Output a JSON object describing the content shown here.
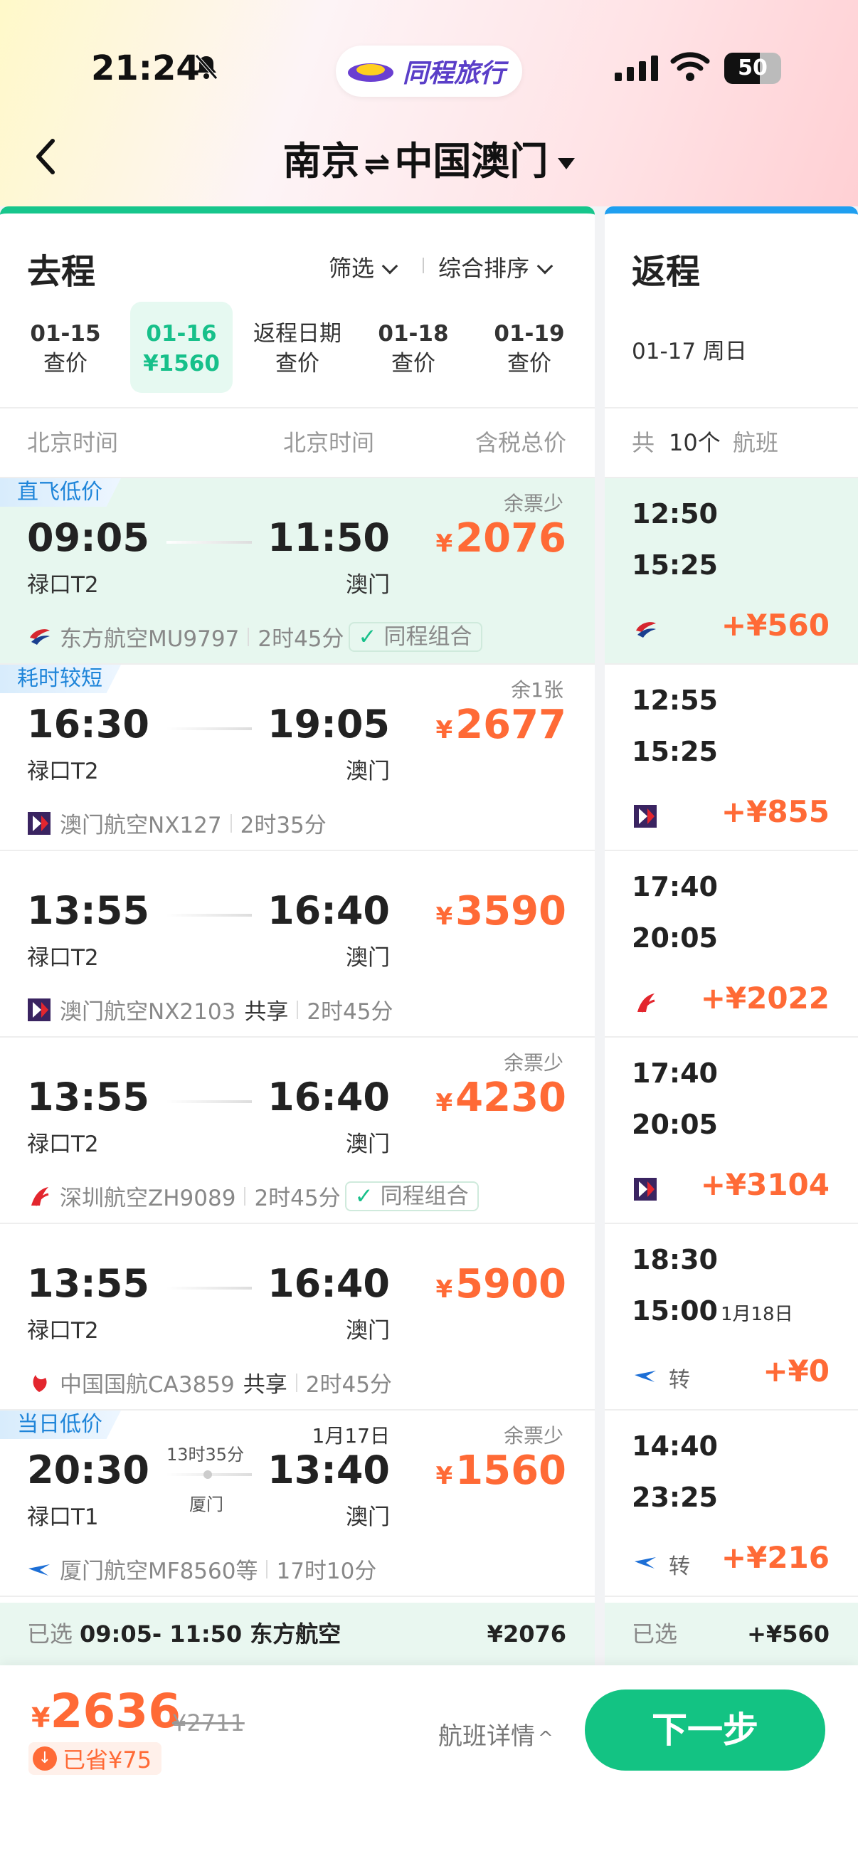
{
  "status": {
    "time": "21:24",
    "battery": "50"
  },
  "brand": {
    "name": "同程旅行"
  },
  "route": {
    "from": "南京",
    "arrow": "⇌",
    "to": "中国澳门"
  },
  "outbound": {
    "title": "去程",
    "filter_label": "筛选",
    "sort_label": "综合排序",
    "dates": [
      {
        "date": "01-15",
        "sub": "查价",
        "active": false
      },
      {
        "date": "01-16",
        "sub": "¥1560",
        "active": true
      },
      {
        "date": "返程日期",
        "sub": "查价",
        "active": false
      },
      {
        "date": "01-18",
        "sub": "查价",
        "active": false
      },
      {
        "date": "01-19",
        "sub": "查价",
        "active": false
      }
    ],
    "col_dep": "北京时间",
    "col_arr": "北京时间",
    "col_price": "含税总价",
    "flights": [
      {
        "tag": "直飞低价",
        "dep": "09:05",
        "arr": "11:50",
        "dep_ap": "禄口T2",
        "arr_ap": "澳门",
        "price": "2076",
        "note": "余票少",
        "airline": "东方航空MU9797",
        "share": "",
        "dur": "2时45分",
        "combo": "同程组合",
        "logo": "china-eastern"
      },
      {
        "tag": "耗时较短",
        "dep": "16:30",
        "arr": "19:05",
        "dep_ap": "禄口T2",
        "arr_ap": "澳门",
        "price": "2677",
        "note": "余1张",
        "airline": "澳门航空NX127",
        "share": "",
        "dur": "2时35分",
        "combo": "",
        "logo": "air-macau"
      },
      {
        "tag": "",
        "dep": "13:55",
        "arr": "16:40",
        "dep_ap": "禄口T2",
        "arr_ap": "澳门",
        "price": "3590",
        "note": "",
        "airline": "澳门航空NX2103",
        "share": "共享",
        "dur": "2时45分",
        "combo": "",
        "logo": "air-macau"
      },
      {
        "tag": "",
        "dep": "13:55",
        "arr": "16:40",
        "dep_ap": "禄口T2",
        "arr_ap": "澳门",
        "price": "4230",
        "note": "余票少",
        "airline": "深圳航空ZH9089",
        "share": "",
        "dur": "2时45分",
        "combo": "同程组合",
        "logo": "shenzhen"
      },
      {
        "tag": "",
        "dep": "13:55",
        "arr": "16:40",
        "dep_ap": "禄口T2",
        "arr_ap": "澳门",
        "price": "5900",
        "note": "",
        "airline": "中国国航CA3859",
        "share": "共享",
        "dur": "2时45分",
        "combo": "",
        "logo": "air-china"
      },
      {
        "tag": "当日低价",
        "dep": "20:30",
        "arr": "13:40",
        "dep_ap": "禄口T1",
        "arr_ap": "澳门",
        "price": "1560",
        "note": "余票少",
        "airline": "厦门航空MF8560等",
        "share": "",
        "dur": "17时10分",
        "combo": "",
        "logo": "xiamen",
        "arr_date": "1月17日",
        "stop_dur": "13时35分",
        "stop": "厦门"
      }
    ],
    "selected": {
      "label": "已选",
      "text": "09:05- 11:50 东方航空",
      "price": "¥2076"
    }
  },
  "return": {
    "title": "返程",
    "date": "01-17 周日",
    "count_label": "共",
    "count": "10个",
    "count_unit": "航班",
    "flights": [
      {
        "dep": "12:50",
        "arr": "15:25",
        "price": "+¥560",
        "logo": "china-eastern",
        "transfer": "",
        "arr_note": ""
      },
      {
        "dep": "12:55",
        "arr": "15:25",
        "price": "+¥855",
        "logo": "air-macau",
        "transfer": "",
        "arr_note": ""
      },
      {
        "dep": "17:40",
        "arr": "20:05",
        "price": "+¥2022",
        "logo": "shenzhen",
        "transfer": "",
        "arr_note": ""
      },
      {
        "dep": "17:40",
        "arr": "20:05",
        "price": "+¥3104",
        "logo": "air-macau",
        "transfer": "",
        "arr_note": ""
      },
      {
        "dep": "18:30",
        "arr": "15:00",
        "price": "+¥0",
        "logo": "xiamen",
        "transfer": "转",
        "arr_note": "1月18日"
      },
      {
        "dep": "14:40",
        "arr": "23:25",
        "price": "+¥216",
        "logo": "xiamen",
        "transfer": "转",
        "arr_note": ""
      }
    ],
    "selected": {
      "label": "已选",
      "price": "+¥560"
    }
  },
  "footer": {
    "total": "2636",
    "original": "¥2711",
    "saved": "已省¥75",
    "detail": "航班详情",
    "next": "下一步"
  },
  "colors": {
    "accent": "#13c383",
    "price": "#ff6a36",
    "return_accent": "#1f9ff0"
  }
}
